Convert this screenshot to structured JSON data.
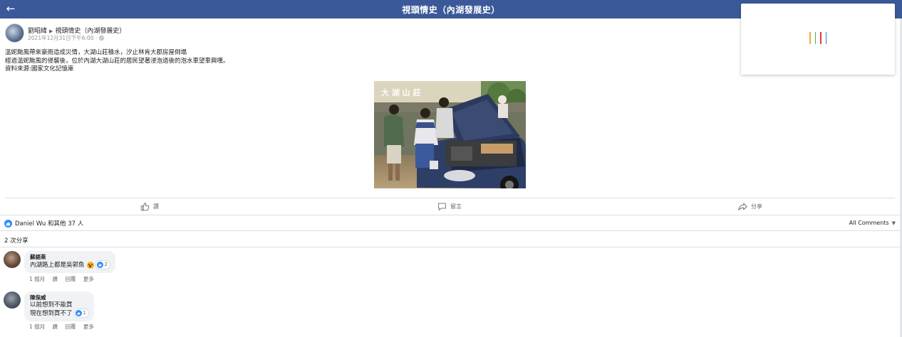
{
  "topbar": {
    "title": "視頭情史（內湖發展史）",
    "back_icon": "arrow-left-icon"
  },
  "post": {
    "author": "劉昭緯",
    "group": "視頭情史（內湖發展史）",
    "date": "2021年12月31日下午6:00 · ",
    "lines": [
      "溫妮颱風帶來豪雨造成災情，大湖山莊積水，汐止林肯大郡房屋倒塌",
      "經過溫妮颱風的侵襲後，位於內湖大湖山莊的居民望著浸泡過後的泡水車望車興嘆。",
      "資料來源:國家文化記憶庫"
    ]
  },
  "actions": {
    "like": "讚",
    "comment": "留言",
    "share": "分享"
  },
  "reactions": {
    "summary": "Daniel Wu 和其他 37 人",
    "all_comments": "All Comments",
    "shares": "2 次分享"
  },
  "comments": [
    {
      "name": "蘇語萊",
      "lines": [
        "內湖路上都是吳郭魚"
      ],
      "reactions": "2",
      "time": "1 個月",
      "like": "讚",
      "reply": "回覆",
      "more": "更多"
    },
    {
      "name": "陳保威",
      "lines": [
        "以前想到不能買",
        "現在想到買不了"
      ],
      "reactions": "1",
      "time": "1 個月",
      "like": "讚",
      "reply": "回覆",
      "more": "更多"
    }
  ],
  "colors": {
    "topbar": "#3b5998",
    "like_blue": "#2e89ff",
    "loader": [
      "#f2a83b",
      "#4caf50",
      "#e53935",
      "#1e88e5"
    ]
  }
}
